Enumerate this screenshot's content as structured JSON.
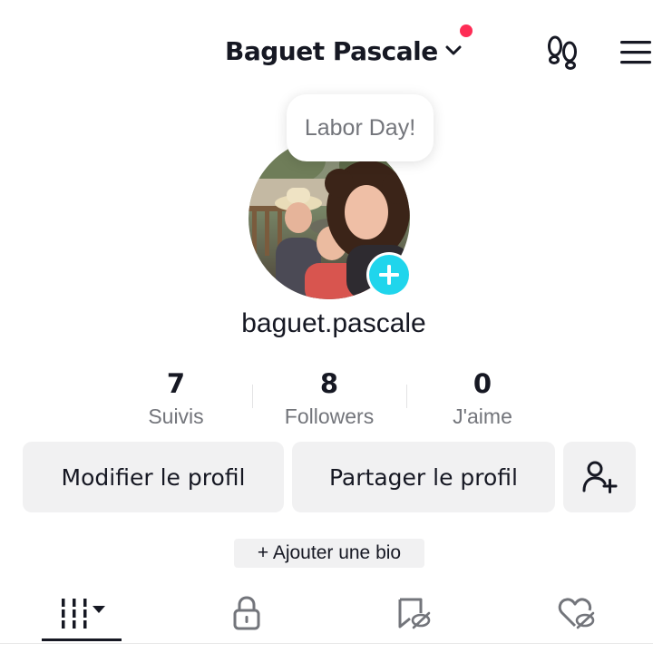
{
  "header": {
    "account_name": "Baguet Pascale",
    "chevron_icon": "chevron-down-icon",
    "notification_dot_color": "#fe2c55",
    "footprint_icon": "footprints-icon",
    "menu_icon": "hamburger-menu-icon"
  },
  "note": {
    "text": "Labor Day!"
  },
  "profile": {
    "add_avatar_icon": "plus-icon",
    "add_avatar_color": "#20d5ec",
    "username": "baguet.pascale"
  },
  "stats": [
    {
      "value": "7",
      "label": "Suivis"
    },
    {
      "value": "8",
      "label": "Followers"
    },
    {
      "value": "0",
      "label": "J'aime"
    }
  ],
  "actions": {
    "edit_profile": "Modifier le profil",
    "share_profile": "Partager le profil",
    "add_friend_icon": "add-friend-icon"
  },
  "bio": {
    "add_label": "+ Ajouter une bio"
  },
  "tabs": [
    {
      "icon": "grid-videos-icon",
      "active": true
    },
    {
      "icon": "lock-icon",
      "active": false
    },
    {
      "icon": "saved-hidden-icon",
      "active": false
    },
    {
      "icon": "liked-hidden-icon",
      "active": false
    }
  ]
}
